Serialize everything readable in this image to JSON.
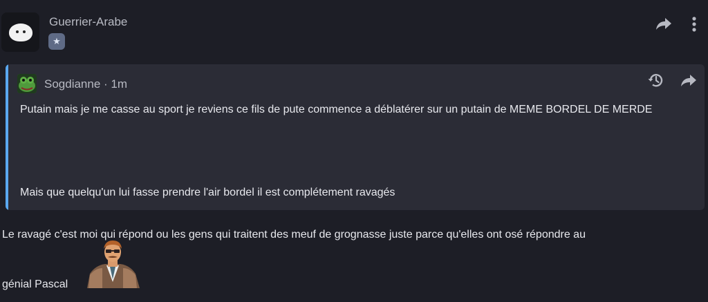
{
  "post": {
    "author": "Guerrier-Arabe",
    "badge_icon": "star-badge-icon"
  },
  "quote": {
    "author": "Sogdianne",
    "time": "· 1m",
    "line1": "Putain mais je me casse au sport je reviens ce fils de pute commence a déblatérer sur un putain de MEME BORDEL DE MERDE",
    "line2": "Mais que quelqu'un lui fasse prendre l'air bordel il est complétement ravagés"
  },
  "reply": {
    "line1": "Le ravagé c'est moi qui répond ou les gens qui traitent des meuf de grognasse juste parce qu'elles ont osé répondre au",
    "line2": "génial Pascal"
  },
  "colors": {
    "background": "#1d1e26",
    "quote_bg": "#2b2c36",
    "quote_bar": "#5aa8f0"
  }
}
